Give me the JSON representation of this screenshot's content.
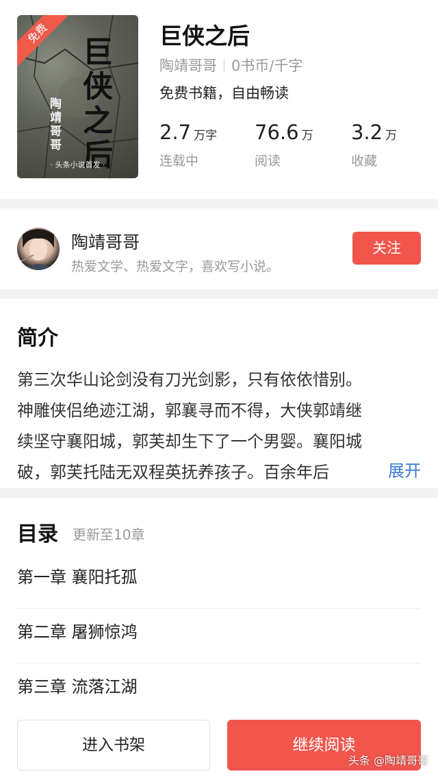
{
  "book": {
    "cover": {
      "ribbon": "免费",
      "title_vertical": "巨侠之后",
      "author_vertical": "陶靖哥哥",
      "footer": "· 头条小说首发 ·"
    },
    "title": "巨侠之后",
    "author": "陶靖哥哥",
    "price": "0书币/千字",
    "tagline": "免费书籍，自由畅读",
    "stats": [
      {
        "num": "2.7",
        "unit": "万字",
        "label": "连载中"
      },
      {
        "num": "76.6",
        "unit": "万",
        "label": "阅读"
      },
      {
        "num": "3.2",
        "unit": "万",
        "label": "收藏"
      }
    ]
  },
  "author": {
    "name": "陶靖哥哥",
    "bio": "热爱文学、热爱文字，喜欢写小说。",
    "follow_label": "关注"
  },
  "intro": {
    "heading": "简介",
    "lines": [
      "第三次华山论剑没有刀光剑影，只有依依惜别。",
      "神雕侠侣绝迹江湖，郭襄寻而不得，大侠郭靖继",
      "续坚守襄阳城，郭芙却生下了一个男婴。襄阳城",
      "破，郭芙托陆无双程英抚养孩子。百余年后"
    ],
    "expand_label": "展开"
  },
  "toc": {
    "heading": "目录",
    "update": "更新至10章",
    "chapters": [
      "第一章 襄阳托孤",
      "第二章 屠狮惊鸿",
      "第三章 流落江湖"
    ]
  },
  "actions": {
    "shelf_label": "进入书架",
    "read_label": "继续阅读"
  },
  "watermark": "头条 @陶靖哥哥"
}
